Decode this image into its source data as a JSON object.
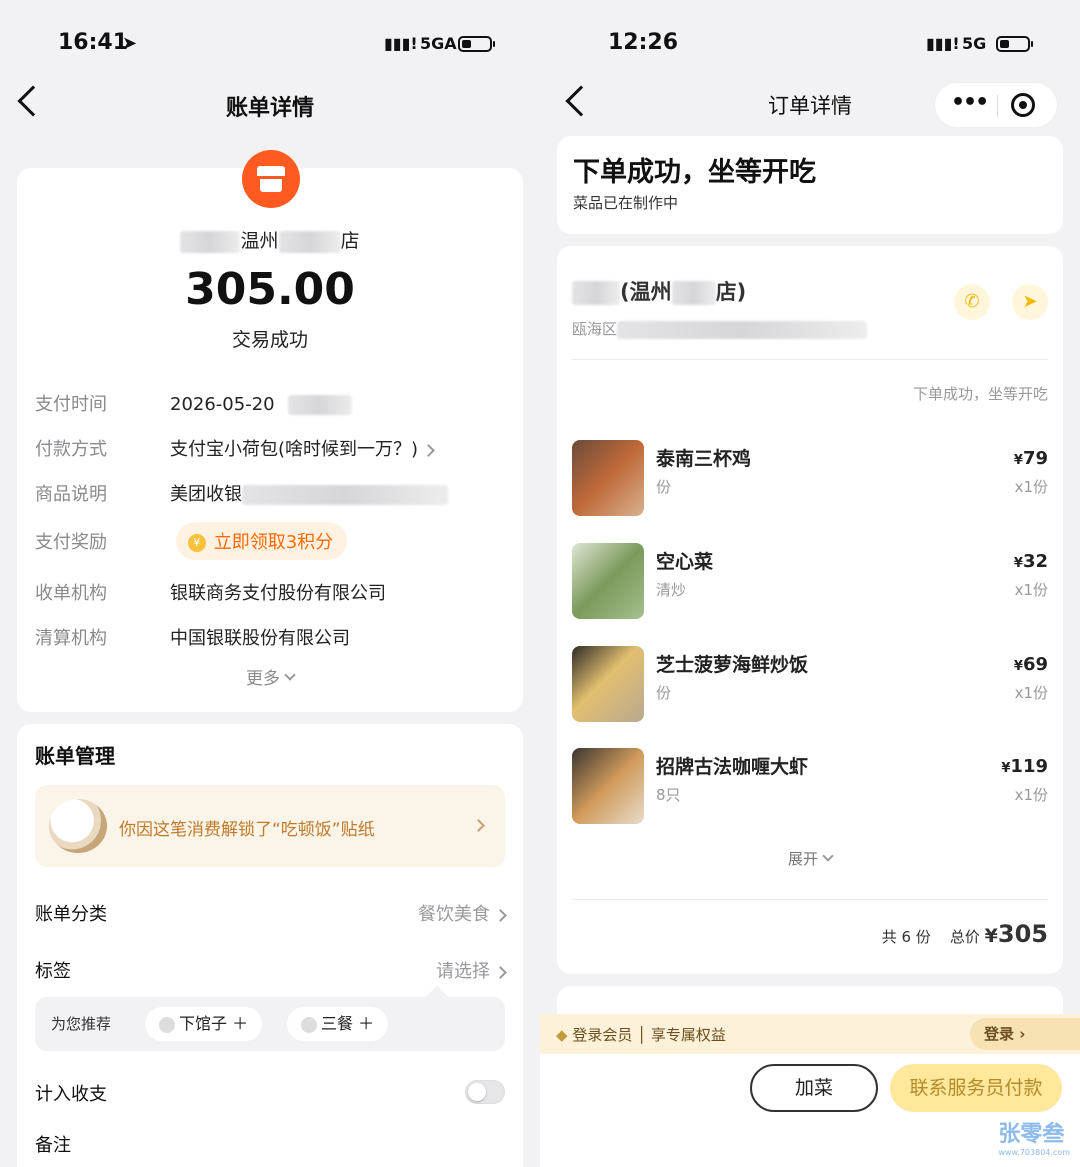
{
  "left": {
    "status": {
      "time": "16:41",
      "network": "5GA"
    },
    "nav": {
      "title": "账单详情"
    },
    "merchant": {
      "name_part1": "温州",
      "name_part2": "店"
    },
    "amount": "305.00",
    "trade_status": "交易成功",
    "details": [
      {
        "label": "支付时间",
        "value": "2026-05-20"
      },
      {
        "label": "付款方式",
        "value": "支付宝小荷包(啥时候到一万？)"
      },
      {
        "label": "商品说明",
        "value": "美团收银"
      },
      {
        "label": "支付奖励",
        "value": "立即领取3积分"
      },
      {
        "label": "收单机构",
        "value": "银联商务支付股份有限公司"
      },
      {
        "label": "清算机构",
        "value": "中国银联股份有限公司"
      }
    ],
    "more": "更多",
    "management": {
      "title": "账单管理",
      "sticker_text": "你因这笔消费解锁了“吃顿饭”贴纸",
      "category_label": "账单分类",
      "category_value": "餐饮美食",
      "tag_label": "标签",
      "tag_value": "请选择",
      "recommend_label": "为您推荐",
      "chips": [
        "下馆子 ＋",
        "三餐 ＋"
      ],
      "income_label": "计入收支",
      "remark_label": "备注"
    }
  },
  "right": {
    "status": {
      "time": "12:26",
      "network": "5G"
    },
    "nav": {
      "title": "订单详情"
    },
    "order_status": {
      "title": "下单成功，坐等开吃",
      "subtitle": "菜品已在制作中"
    },
    "store": {
      "name_part1": "(温州",
      "name_part2": "店)",
      "address_prefix": "瓯海区"
    },
    "status_small": "下单成功，坐等开吃",
    "items": [
      {
        "name": "泰南三杯鸡",
        "spec": "份",
        "price": "79",
        "qty": "x1份"
      },
      {
        "name": "空心菜",
        "spec": "清炒",
        "price": "32",
        "qty": "x1份"
      },
      {
        "name": "芝士菠萝海鲜炒饭",
        "spec": "份",
        "price": "69",
        "qty": "x1份"
      },
      {
        "name": "招牌古法咖喱大虾",
        "spec": "8只",
        "price": "119",
        "qty": "x1份"
      }
    ],
    "expand": "展开",
    "total": {
      "count_text": "共 6 份",
      "label": "总价",
      "currency": "¥",
      "amount": "305"
    },
    "member": {
      "text": "登录会员 │ 享专属权益",
      "login": "登录 ›"
    },
    "buttons": {
      "add": "加菜",
      "pay": "联系服务员付款"
    },
    "watermark": {
      "text": "张零叁",
      "url": "www.703804.com"
    }
  }
}
